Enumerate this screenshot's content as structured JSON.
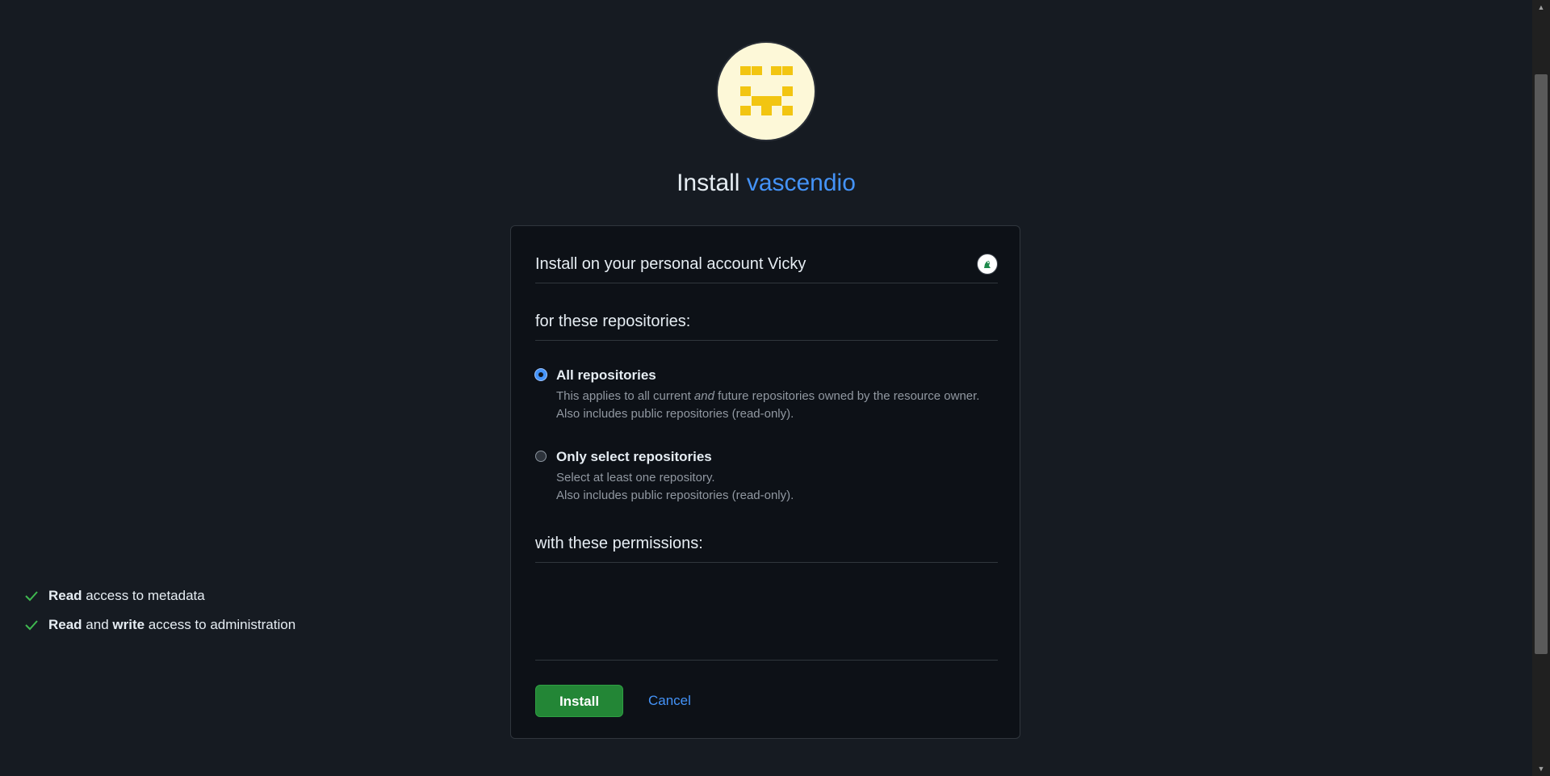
{
  "title": {
    "prefix": "Install",
    "app_name": "vascendio"
  },
  "account": {
    "text": "Install on your personal account Vicky"
  },
  "repositories": {
    "heading": "for these repositories:",
    "options": [
      {
        "label": "All repositories",
        "desc_line1_a": "This applies to all current ",
        "desc_line1_em": "and",
        "desc_line1_b": " future repositories owned by the resource owner.",
        "desc_line2": "Also includes public repositories (read-only).",
        "selected": true
      },
      {
        "label": "Only select repositories",
        "desc_line1": "Select at least one repository.",
        "desc_line2": "Also includes public repositories (read-only).",
        "selected": false
      }
    ]
  },
  "permissions": {
    "heading": "with these permissions:",
    "items": [
      {
        "bold1": "Read",
        "rest": " access to metadata"
      },
      {
        "bold1": "Read",
        "mid": " and ",
        "bold2": "write",
        "rest": " access to administration"
      }
    ]
  },
  "actions": {
    "install_label": "Install",
    "cancel_label": "Cancel"
  },
  "colors": {
    "background": "#161b22",
    "card": "#0d1117",
    "accent": "#4493f8",
    "install_green": "#238636",
    "check_green": "#3fb950",
    "logo_bg": "#fdf8d8",
    "logo_fg": "#f2c511"
  },
  "icons": {
    "check": "check-icon",
    "logo": "app-logo-icon",
    "avatar": "user-avatar"
  }
}
